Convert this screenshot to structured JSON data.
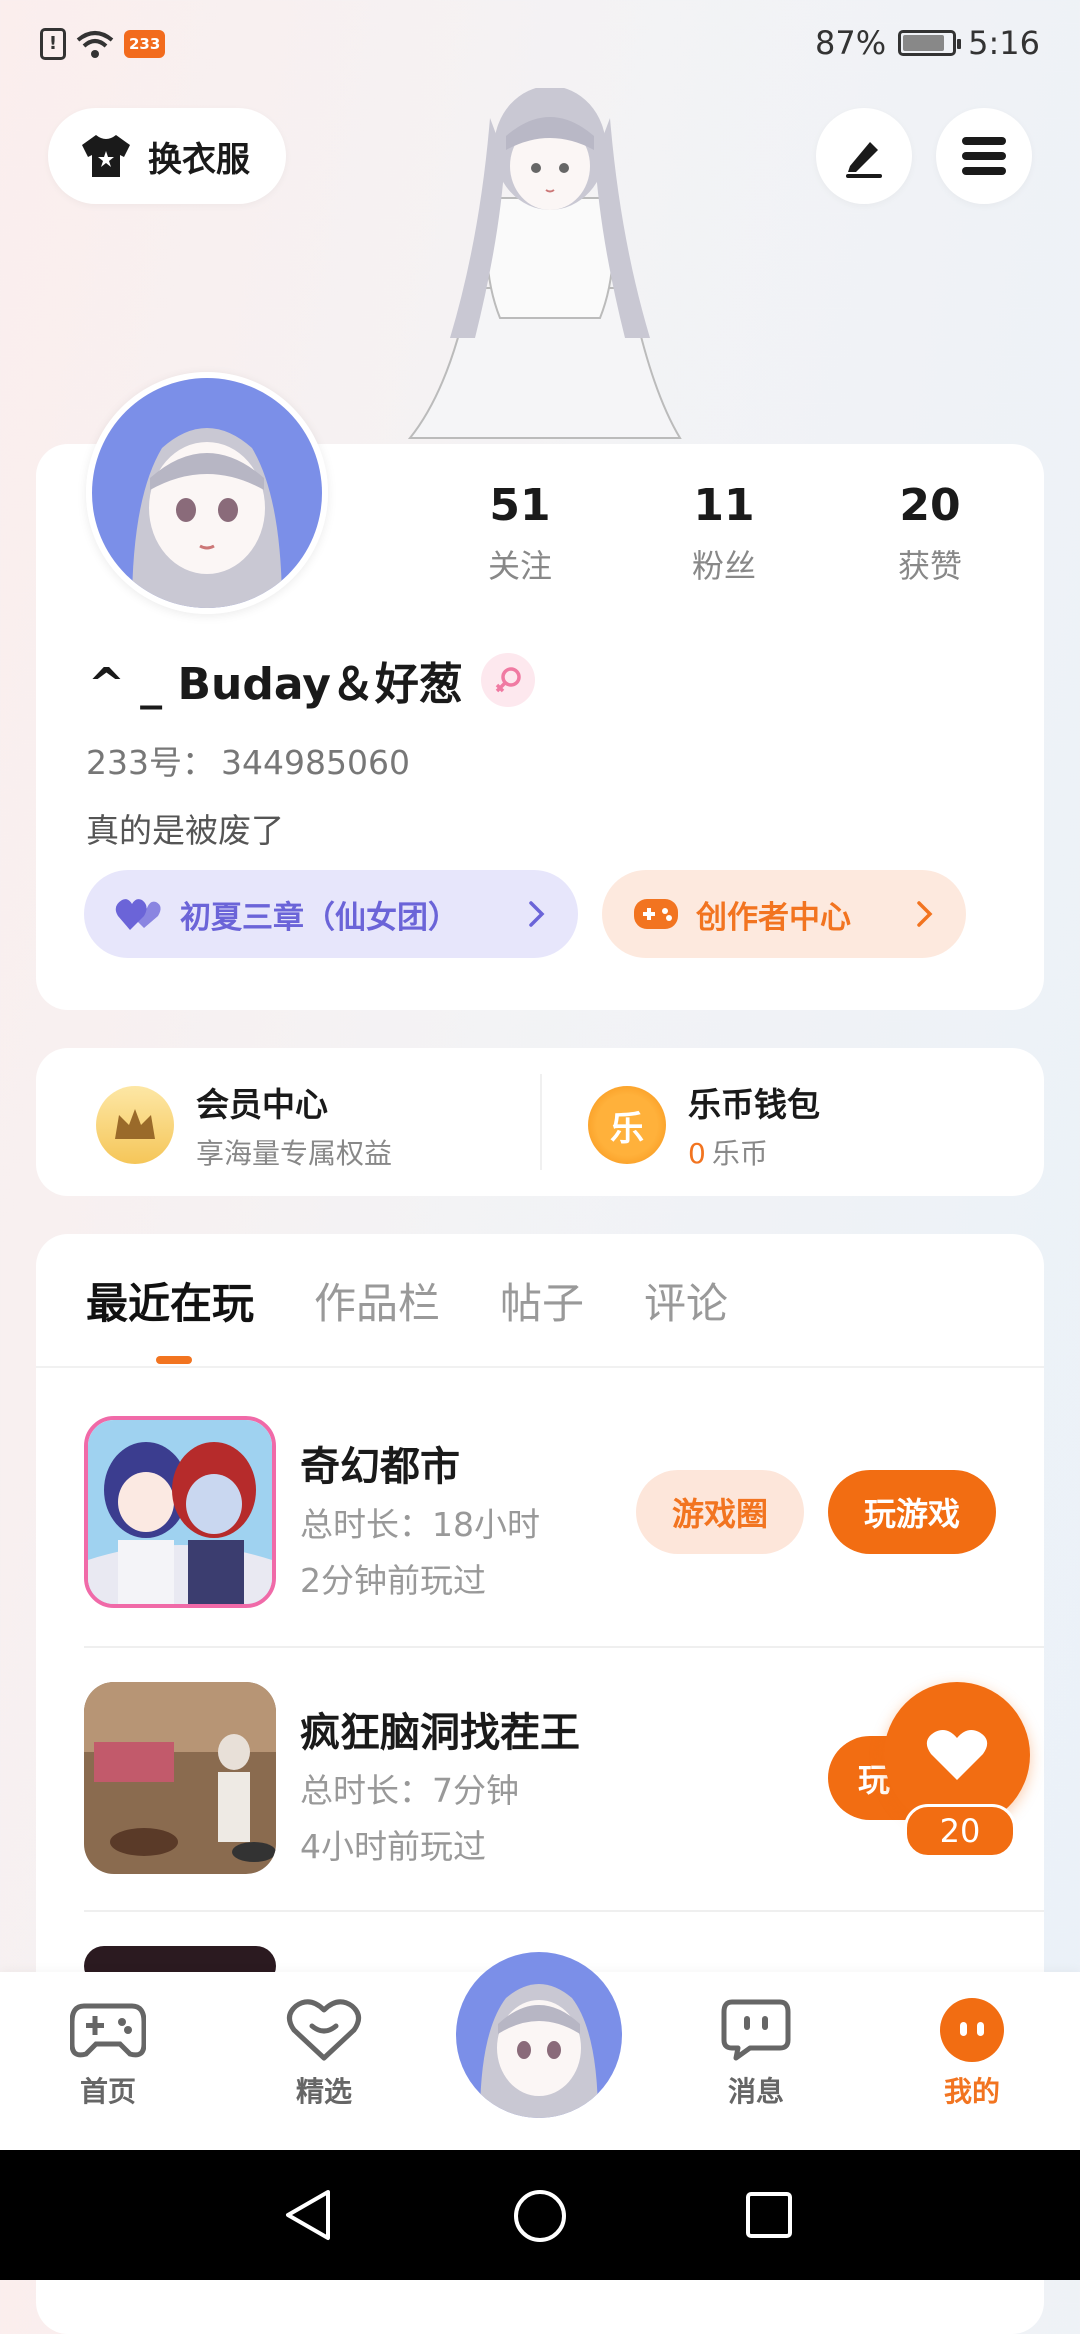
{
  "status_bar": {
    "badge": "233",
    "battery": "87%",
    "battery_level": 0.87,
    "time": "5:16"
  },
  "header": {
    "dress_up_label": "换衣服",
    "icons": [
      "tshirt-icon",
      "edit-icon",
      "menu-icon"
    ]
  },
  "profile": {
    "stats": [
      {
        "value": "51",
        "label": "关注"
      },
      {
        "value": "11",
        "label": "粉丝"
      },
      {
        "value": "20",
        "label": "获赞"
      }
    ],
    "username": "^ _ Buday＆好葱",
    "gender_icon": "female-icon",
    "uid_label": "233号：",
    "uid_value": "344985060",
    "bio": "真的是被废了",
    "group_pill": "初夏三章（仙女团）",
    "creator_pill": "创作者中心"
  },
  "member": {
    "vip_title": "会员中心",
    "vip_sub": "享海量专属权益",
    "wallet_title": "乐币钱包",
    "wallet_icon_char": "乐",
    "wallet_amount": "0",
    "wallet_unit": "乐币"
  },
  "tabs": [
    "最近在玩",
    "作品栏",
    "帖子",
    "评论"
  ],
  "games": [
    {
      "title": "奇幻都市",
      "duration": "总时长：18小时",
      "last_played": "2分钟前玩过",
      "circle_label": "游戏圈",
      "play_label": "玩游戏"
    },
    {
      "title": "疯狂脑洞找茬王",
      "duration": "总时长：7分钟",
      "last_played": "4小时前玩过",
      "play_label": "玩"
    }
  ],
  "floating_like": {
    "count": "20"
  },
  "bottom_nav": [
    {
      "label": "首页",
      "icon": "gamepad-icon"
    },
    {
      "label": "精选",
      "icon": "heart-chat-icon"
    },
    {
      "label": "",
      "icon": "avatar-center"
    },
    {
      "label": "消息",
      "icon": "message-icon"
    },
    {
      "label": "我的",
      "icon": "mine-icon"
    }
  ],
  "colors": {
    "accent": "#f26d12",
    "group_purple": "#6b64d8",
    "group_bg": "#e7e6fb"
  }
}
